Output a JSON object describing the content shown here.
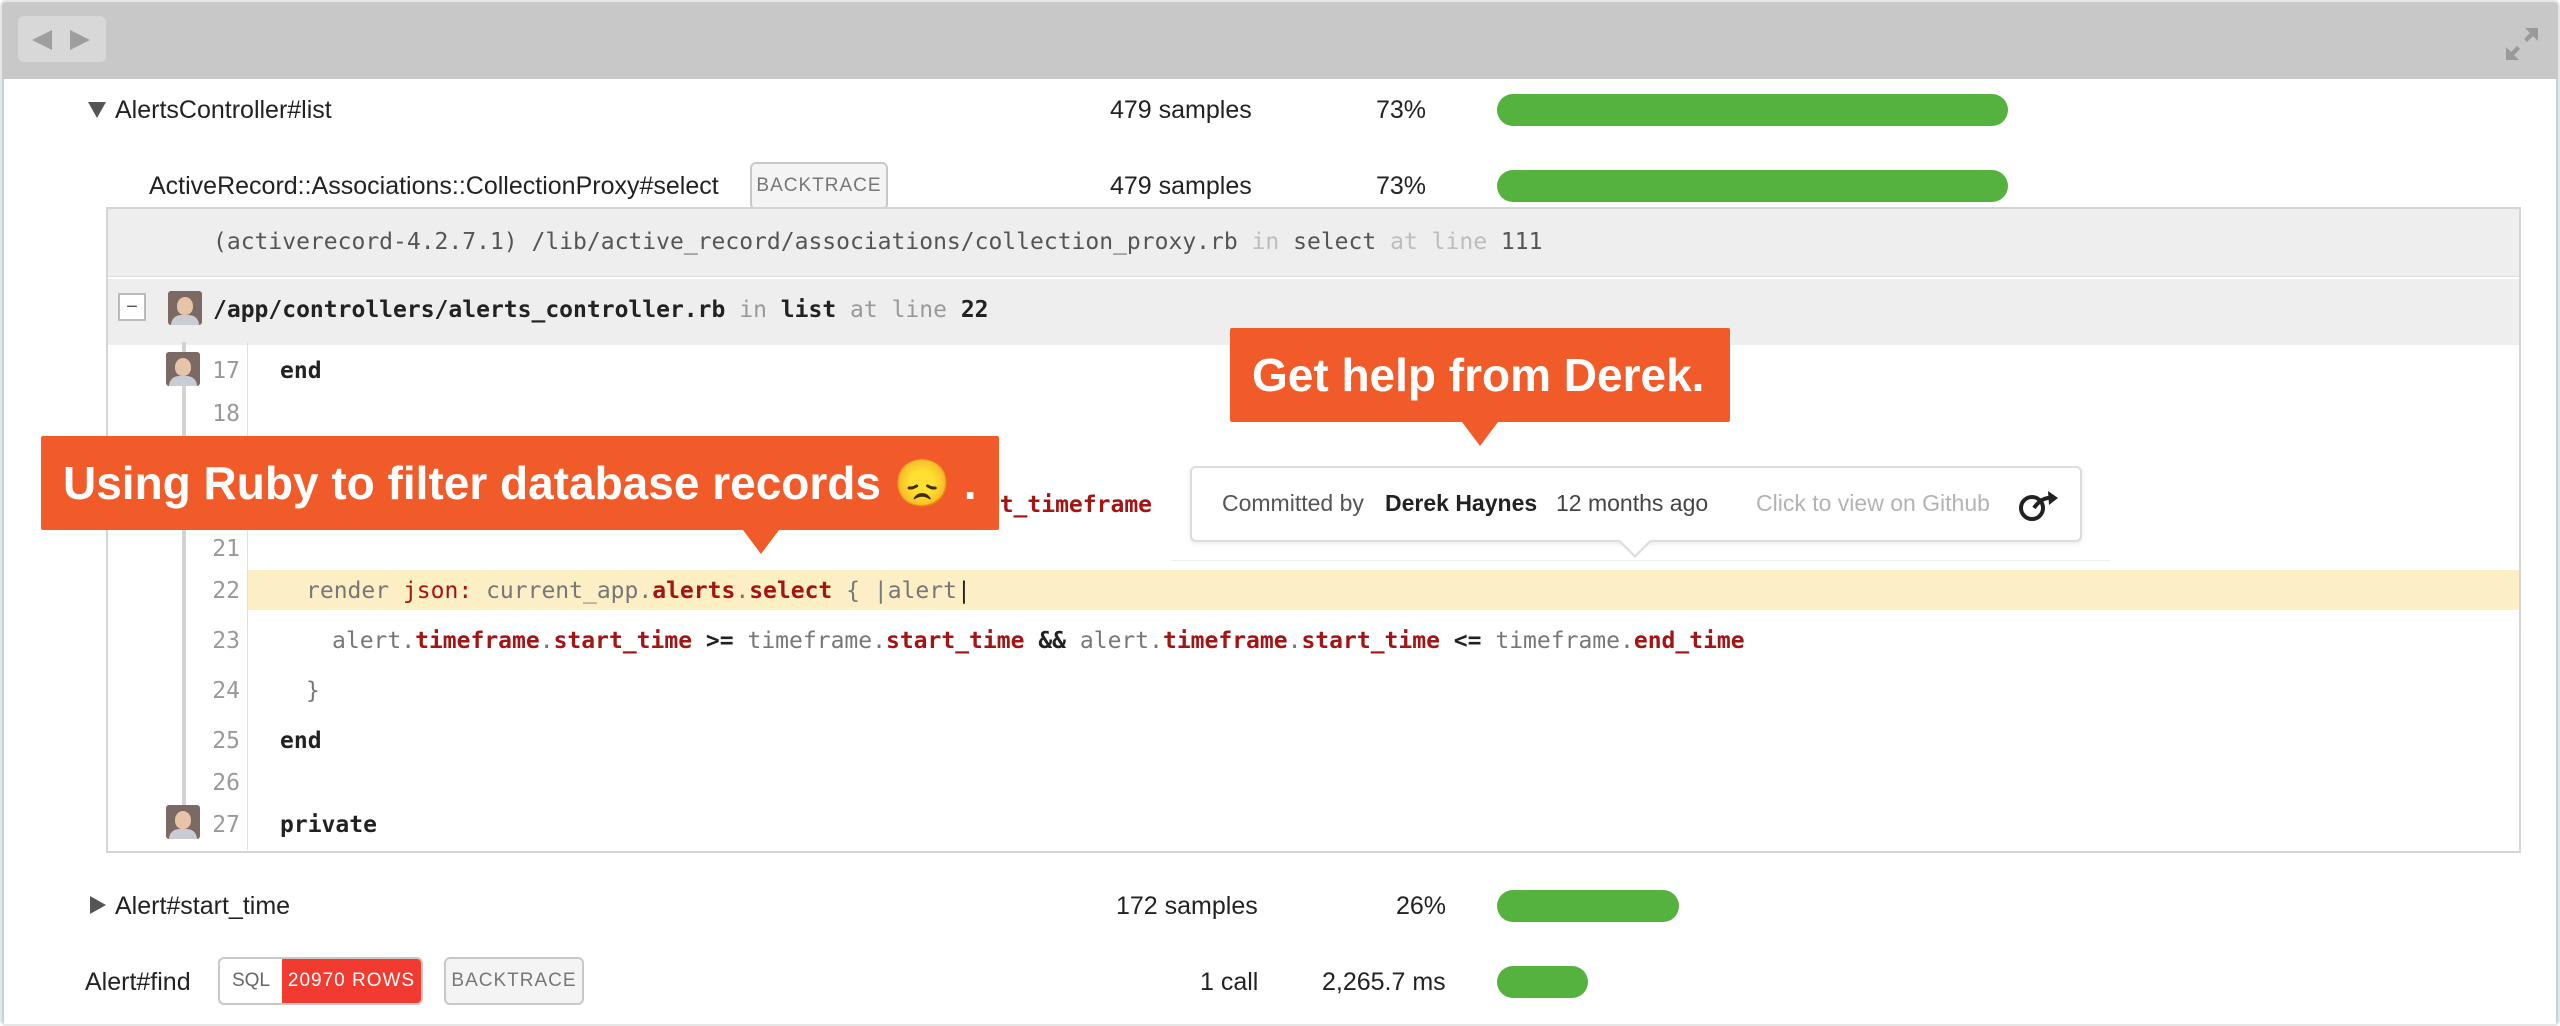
{
  "rows": {
    "alerts_list": {
      "name": "AlertsController#list",
      "samples": "479 samples",
      "pct": "73%",
      "fill": 0.73
    },
    "collection_proxy": {
      "name": "ActiveRecord::Associations::CollectionProxy#select",
      "tag": "BACKTRACE",
      "samples": "479 samples",
      "pct": "73%",
      "fill": 0.73
    },
    "alert_start_time": {
      "name": "Alert#start_time",
      "samples": "172 samples",
      "pct": "26%",
      "fill": 0.26
    },
    "alert_find": {
      "name": "Alert#find",
      "sql": "SQL",
      "rows_badge": "20970 ROWS",
      "tag": "BACKTRACE",
      "calls": "1 call",
      "time": "2,265.7 ms",
      "fill": 0.13
    }
  },
  "backtrace": {
    "frame1": {
      "gem": "(activerecord-4.2.7.1)",
      "path": "/lib/active_record/associations/collection_proxy.rb",
      "in": "in",
      "method": "select",
      "at": "at",
      "line_word": "line",
      "line": "111"
    },
    "frame2": {
      "toggle": "−",
      "path": "/app/controllers/alerts_controller.rb",
      "in": "in",
      "method": "list",
      "at": "at line",
      "line": "22"
    }
  },
  "code": {
    "l17": {
      "no": "17",
      "text": "end"
    },
    "l18": {
      "no": "18"
    },
    "l20_tail": "ent_timeframe",
    "l21": {
      "no": "21"
    },
    "l22": {
      "no": "22",
      "render": "render",
      "json": "json:",
      "app": "current_app.",
      "alerts": "alerts",
      "dot": ".",
      "select": "select",
      "brace": "{ |",
      "alert": "alert",
      "pipe": "|"
    },
    "l23": {
      "no": "23",
      "a1": "alert.",
      "t1": "timeframe",
      "d1": ".",
      "s1": "start_time",
      "op1": ">=",
      "tf1": "timeframe.",
      "s2": "start_time",
      "and": "&&",
      "a2": "alert.",
      "t2": "timeframe",
      "d2": ".",
      "s3": "start_time",
      "op2": "<=",
      "tf2": "timeframe.",
      "e1": "end_time"
    },
    "l24": {
      "no": "24",
      "text": "}"
    },
    "l25": {
      "no": "25",
      "text": "end"
    },
    "l26": {
      "no": "26"
    },
    "l27": {
      "no": "27",
      "text": "private"
    }
  },
  "tooltip": {
    "committed_by": "Committed by",
    "author": "Derek Haynes",
    "ago": "12 months ago",
    "github": "Click to view on Github"
  },
  "callouts": {
    "ruby": "Using Ruby to filter database records 😞 .",
    "derek": "Get help from Derek."
  },
  "icons": {
    "back": "back-arrow-icon",
    "forward": "forward-arrow-icon",
    "expand": "expand-icon",
    "github_link": "external-link-icon"
  },
  "colors": {
    "bar": "#55b23e",
    "callout": "#f15a29",
    "rows_badge": "#f23b30",
    "highlight": "#fcefc6"
  }
}
